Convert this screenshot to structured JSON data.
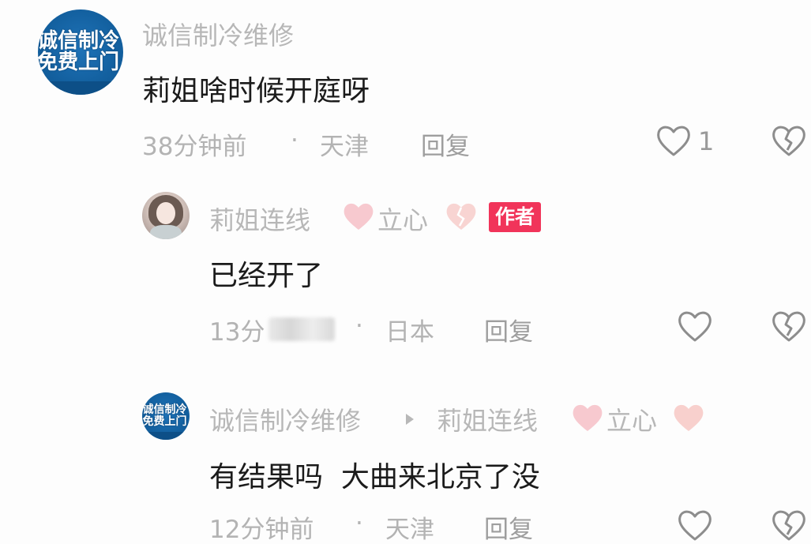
{
  "comments": [
    {
      "avatar_lines": [
        "诚信制冷",
        "免费上门"
      ],
      "username": "诚信制冷维修",
      "content": "莉姐啥时候开庭呀",
      "time": "38分钟前",
      "separator": "·",
      "location": "天津",
      "reply_label": "回复",
      "like_count": "1"
    },
    {
      "username": "莉姐连线",
      "username_suffix": "立心",
      "badge": "作者",
      "content": "已经开了",
      "time": "13分",
      "separator": "·",
      "location": "日本",
      "reply_label": "回复"
    },
    {
      "avatar_lines": [
        "诚信制冷",
        "免费上门"
      ],
      "username": "诚信制冷维修",
      "reply_to": "莉姐连线",
      "reply_to_suffix": "立心",
      "content": "有结果吗  大曲来北京了没",
      "time": "12分钟前",
      "separator": "·",
      "location": "天津",
      "reply_label": "回复"
    }
  ],
  "colors": {
    "badge": "#f1345a",
    "heart_emoji": "#f7c9cf",
    "avatar_blue": "#13609f"
  },
  "icons": {
    "like": "heart-outline-icon",
    "dislike": "broken-heart-icon",
    "reply_arrow": "triangle-right-icon"
  }
}
